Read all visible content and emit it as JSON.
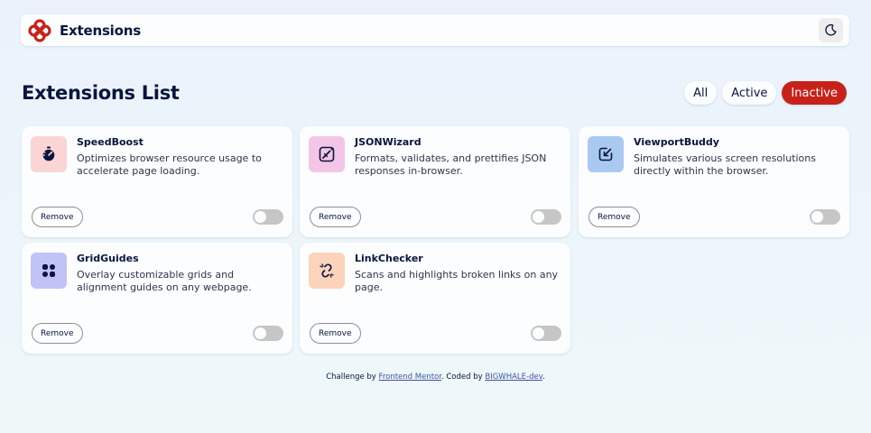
{
  "header": {
    "brand_name": "Extensions",
    "logo_icon": "logo-icon",
    "theme_icon": "moon-icon"
  },
  "main": {
    "title": "Extensions List",
    "filters": [
      {
        "label": "All",
        "selected": false
      },
      {
        "label": "Active",
        "selected": false
      },
      {
        "label": "Inactive",
        "selected": true
      }
    ]
  },
  "extensions": [
    {
      "name": "SpeedBoost",
      "description": "Optimizes browser resource usage to accelerate page loading.",
      "icon": "stopwatch-icon",
      "icon_bg": "#fbd5d5",
      "remove_label": "Remove",
      "enabled": false
    },
    {
      "name": "JSONWizard",
      "description": "Formats, validates, and prettifies JSON responses in-browser.",
      "icon": "wand-icon",
      "icon_bg": "#f3c6e8",
      "remove_label": "Remove",
      "enabled": false
    },
    {
      "name": "ViewportBuddy",
      "description": "Simulates various screen resolutions directly within the browser.",
      "icon": "viewport-icon",
      "icon_bg": "#a9c9f1",
      "remove_label": "Remove",
      "enabled": false
    },
    {
      "name": "GridGuides",
      "description": "Overlay customizable grids and alignment guides on any webpage.",
      "icon": "grid-icon",
      "icon_bg": "#c1c3f6",
      "remove_label": "Remove",
      "enabled": false
    },
    {
      "name": "LinkChecker",
      "description": "Scans and highlights broken links on any page.",
      "icon": "link-icon",
      "icon_bg": "#fcd3bb",
      "remove_label": "Remove",
      "enabled": false
    }
  ],
  "footer": {
    "prefix": "Challenge by ",
    "link1": "Frontend Mentor",
    "middle": ". Coded by ",
    "link2": "BIGWHALE-dev",
    "suffix": "."
  },
  "colors": {
    "accent": "#c7221a",
    "text": "#09153e",
    "card_bg": "#fbfdfe",
    "toggle_off": "#c6c6c6"
  }
}
